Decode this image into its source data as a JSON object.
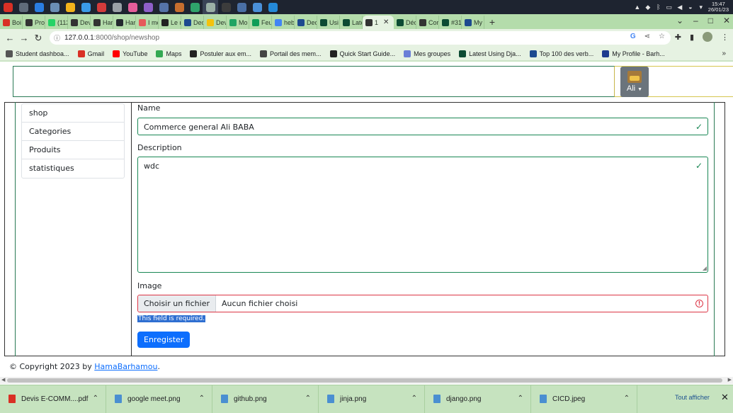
{
  "taskbar": {
    "apps": [
      {
        "name": "mail-icon",
        "color": "#d93025"
      },
      {
        "name": "files-icon",
        "color": "#5f6b7a"
      },
      {
        "name": "store-icon",
        "color": "#2a7de1"
      },
      {
        "name": "photos-icon",
        "color": "#6b8fb5"
      },
      {
        "name": "chrome-icon",
        "color": "#f2b31b"
      },
      {
        "name": "s-app-icon",
        "color": "#3a9be8"
      },
      {
        "name": "triangle-app-icon",
        "color": "#d43b3b"
      },
      {
        "name": "steam-icon",
        "color": "#9aa0a6"
      },
      {
        "name": "colorful-app-icon",
        "color": "#e55d9a"
      },
      {
        "name": "github-desktop-icon",
        "color": "#8e5fc9"
      },
      {
        "name": "circle-app-icon",
        "color": "#5573a8"
      },
      {
        "name": "palette-app-icon",
        "color": "#c76e2e"
      },
      {
        "name": "green-app-icon",
        "color": "#2fa46b"
      },
      {
        "name": "notes-app-icon",
        "color": "#9bb0a6"
      },
      {
        "name": "terminal-icon",
        "color": "#3c3c3c"
      },
      {
        "name": "editor-app-icon",
        "color": "#4a6fa5"
      },
      {
        "name": "chat-app-icon",
        "color": "#4a90d9"
      },
      {
        "name": "vscode-icon",
        "color": "#2489d8"
      }
    ],
    "clock_time": "15:47",
    "clock_date": "26/01/23"
  },
  "tabs": [
    {
      "label": "Boi",
      "fav_color": "#d93025"
    },
    {
      "label": "Proj",
      "fav_color": "#333333"
    },
    {
      "label": "(112",
      "fav_color": "#25d366"
    },
    {
      "label": "Dev",
      "fav_color": "#333333"
    },
    {
      "label": "Har",
      "fav_color": "#333333"
    },
    {
      "label": "Har",
      "fav_color": "#24292f"
    },
    {
      "label": "I me",
      "fav_color": "#e65a5a"
    },
    {
      "label": "Le r",
      "fav_color": "#222222"
    },
    {
      "label": "Dec",
      "fav_color": "#1d4a8f"
    },
    {
      "label": "Dev",
      "fav_color": "#f4c20d"
    },
    {
      "label": "Mo",
      "fav_color": "#1fa463"
    },
    {
      "label": "Feu",
      "fav_color": "#0f9d58"
    },
    {
      "label": "heb",
      "fav_color": "#4285f4"
    },
    {
      "label": "Dec",
      "fav_color": "#1d4a8f"
    },
    {
      "label": "Usi",
      "fav_color": "#0c4b33"
    },
    {
      "label": "Late",
      "fav_color": "#0c4b33"
    },
    {
      "label": "1",
      "fav_color": "#333333",
      "active": true
    },
    {
      "label": "Déc",
      "fav_color": "#0c4b33"
    },
    {
      "label": "Cor",
      "fav_color": "#333333"
    },
    {
      "label": "#31",
      "fav_color": "#0c4b33"
    },
    {
      "label": "My",
      "fav_color": "#1d4a8f"
    }
  ],
  "url": {
    "host": "127.0.0.1",
    "path": ":8000/shop/newshop"
  },
  "bookmarks": [
    {
      "label": "Student dashboa...",
      "fav_color": "#555555"
    },
    {
      "label": "Gmail",
      "fav_color": "#d93025"
    },
    {
      "label": "YouTube",
      "fav_color": "#ff0000"
    },
    {
      "label": "Maps",
      "fav_color": "#34a853"
    },
    {
      "label": "Postuler aux em...",
      "fav_color": "#222222"
    },
    {
      "label": "Portail des mem...",
      "fav_color": "#444444"
    },
    {
      "label": "Quick Start Guide...",
      "fav_color": "#222222"
    },
    {
      "label": "Mes groupes",
      "fav_color": "#6b7fd7"
    },
    {
      "label": "Latest Using Dja...",
      "fav_color": "#0c4b33"
    },
    {
      "label": "Top 100 des verb...",
      "fav_color": "#1d4a8f"
    },
    {
      "label": "My Profile - Barh...",
      "fav_color": "#1d3b8f"
    }
  ],
  "user_menu": {
    "name": "Ali"
  },
  "sidebar": {
    "items": [
      "shop",
      "Categories",
      "Produits",
      "statistiques"
    ]
  },
  "form": {
    "name_label": "Name",
    "name_value": "Commerce general Ali BABA",
    "description_label": "Description",
    "description_value": "wdc",
    "image_label": "Image",
    "file_button": "Choisir un fichier",
    "file_status": "Aucun fichier choisi",
    "error": "This field is required.",
    "submit": "Enregister"
  },
  "footer": {
    "text": "© Copyright 2023 by ",
    "link": "HamaBarhamou",
    "suffix": "."
  },
  "downloads": [
    {
      "name": "Devis E-COMM....pdf",
      "icon_color": "#d93025"
    },
    {
      "name": "google meet.png",
      "icon_color": "#4a8fd1"
    },
    {
      "name": "github.png",
      "icon_color": "#4a8fd1"
    },
    {
      "name": "jinja.png",
      "icon_color": "#4a8fd1"
    },
    {
      "name": "django.png",
      "icon_color": "#4a8fd1"
    },
    {
      "name": "CICD.jpeg",
      "icon_color": "#4a8fd1"
    }
  ],
  "show_all": "Tout afficher"
}
